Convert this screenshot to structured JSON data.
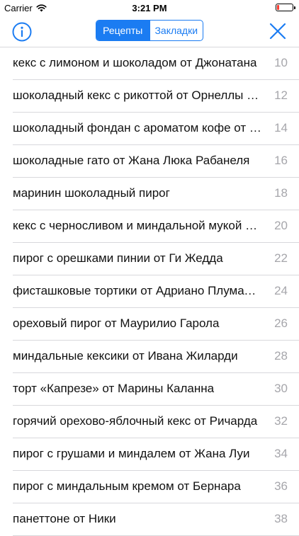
{
  "status_bar": {
    "carrier": "Carrier",
    "time": "3:21 PM",
    "wifi_icon": "wifi-icon",
    "battery_color": "#ff3b30"
  },
  "nav": {
    "info_icon": "info-icon",
    "segments": [
      {
        "label": "Рецепты",
        "active": true
      },
      {
        "label": "Закладки",
        "active": false
      }
    ],
    "close_icon": "close-icon",
    "accent_color": "#1b7cf2"
  },
  "recipes": [
    {
      "title": "кекс с лимоном и шоколадом от Джонатана",
      "page": "10"
    },
    {
      "title": "шоколадный кекс с рикоттой от Орнеллы Мариано",
      "page": "12"
    },
    {
      "title": "шоколадный фондан с ароматом кофе от Марко",
      "page": "14"
    },
    {
      "title": "шоколадные гато от Жана Люка Рабанеля",
      "page": "16"
    },
    {
      "title": "маринин шоколадный пирог",
      "page": "18"
    },
    {
      "title": "кекс с черносливом и миндальной мукой от Анны",
      "page": "20"
    },
    {
      "title": "пирог с орешками пинии от Ги Жедда",
      "page": "22"
    },
    {
      "title": "фисташковые тортики от Адриано Плумаччи",
      "page": "24"
    },
    {
      "title": "ореховый пирог от Маурилио Гарола",
      "page": "26"
    },
    {
      "title": "миндальные кексики от Ивана Жиларди",
      "page": "28"
    },
    {
      "title": "торт «Капрезе» от Марины Каланна",
      "page": "30"
    },
    {
      "title": "горячий орехово-яблочный кекс от Ричарда",
      "page": "32"
    },
    {
      "title": "пирог с грушами и миндалем от Жана Луи",
      "page": "34"
    },
    {
      "title": "пирог с миндальным кремом от Бернара",
      "page": "36"
    },
    {
      "title": "панеттоне от Ники",
      "page": "38"
    }
  ]
}
